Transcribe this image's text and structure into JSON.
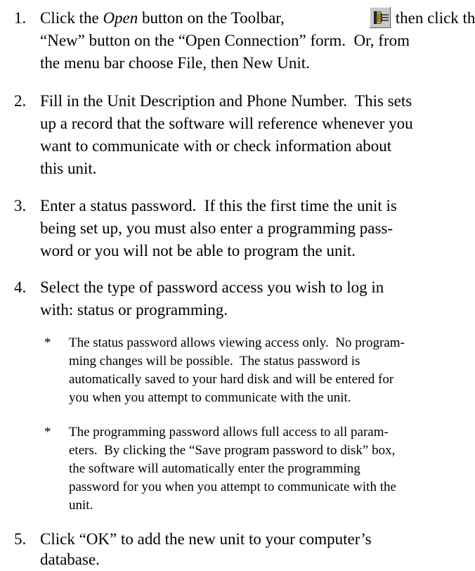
{
  "steps": [
    {
      "number": "1.",
      "line1_part1": "Click the ",
      "line1_em": "Open",
      "line1_part2": " button on the Toolbar, ",
      "line1_part3": " then click the",
      "line2": "“New” button on the “Open Connection” form.  Or, from",
      "line3": "the menu bar choose File, then New Unit.",
      "toolbar_icon": "open-connection-icon"
    },
    {
      "number": "2.",
      "lines": [
        "Fill in the Unit Description and Phone Number.  This sets",
        "up a record that the software will reference whenever you",
        "want to communicate with or check information about",
        "this unit."
      ]
    },
    {
      "number": "3.",
      "lines": [
        "Enter a status password.  If this the first time the unit is",
        "being set up, you must also enter a programming pass-",
        "word or you will not be able to program the unit."
      ]
    },
    {
      "number": "4.",
      "lines": [
        "Select the type of password access you wish to log in",
        "with: status or programming."
      ],
      "notes": [
        {
          "bullet": "*",
          "lines": [
            "The status password allows viewing access only.  No program-",
            "ming changes will be possible.  The status password is",
            "automatically saved to your hard disk and will be entered for",
            "you when you attempt to communicate with the unit."
          ]
        },
        {
          "bullet": "*",
          "lines": [
            "The programming password allows full access to all param-",
            "eters.  By clicking the “Save program password to disk” box,",
            "the software will automatically enter the programming",
            "password for you when you attempt to communicate with the",
            "unit."
          ]
        }
      ]
    },
    {
      "number": "5.",
      "lines": [
        "Click “OK” to add the new unit to your computer’s",
        "database."
      ]
    }
  ]
}
